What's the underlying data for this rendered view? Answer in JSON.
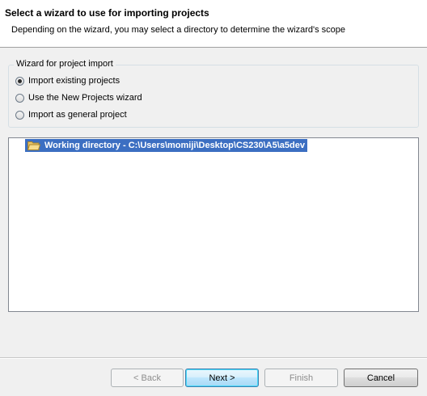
{
  "header": {
    "title": "Select a wizard to use for importing projects",
    "description": "Depending on the wizard, you may select a directory to determine the wizard's scope"
  },
  "wizard_group": {
    "legend": "Wizard for project import",
    "options": [
      {
        "label": "Import existing projects",
        "checked": true
      },
      {
        "label": "Use the New Projects wizard",
        "checked": false
      },
      {
        "label": "Import as general project",
        "checked": false
      }
    ]
  },
  "tree": {
    "items": [
      {
        "label": "Working directory - C:\\Users\\momiji\\Desktop\\CS230\\A5\\a5dev",
        "icon": "open-folder-icon",
        "selected": true
      }
    ]
  },
  "buttons": {
    "back": "< Back",
    "next": "Next >",
    "finish": "Finish",
    "cancel": "Cancel"
  },
  "colors": {
    "selection": "#3c6fc2",
    "header_bg": "#ffffff",
    "body_bg": "#f0f0f0"
  }
}
